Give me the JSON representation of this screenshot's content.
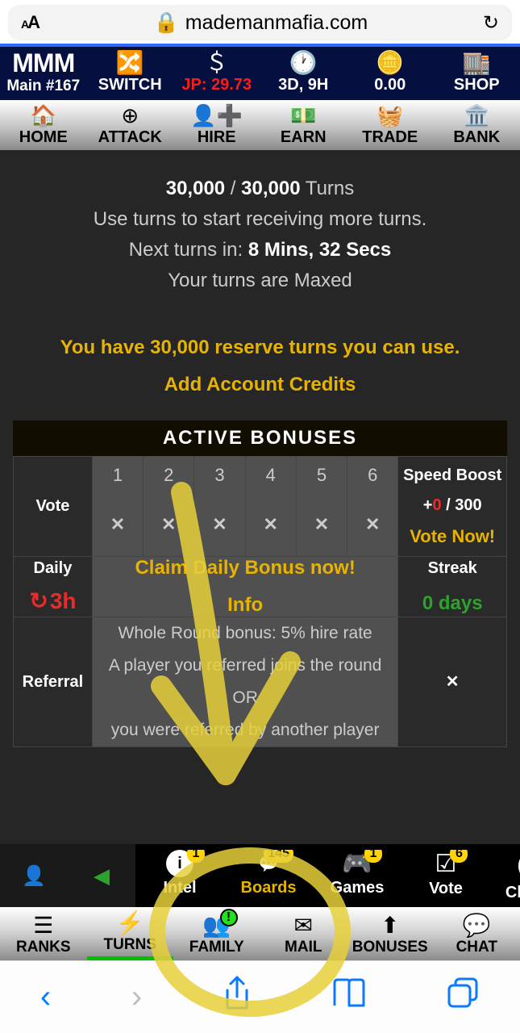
{
  "browser": {
    "url": "mademanmafia.com"
  },
  "nav1": {
    "mmm": "MMM",
    "main": "Main #167",
    "switch": "SWITCH",
    "jp_prefix": "JP: ",
    "jp_val": "29.73",
    "time": "3D, 9H",
    "coins": "0.00",
    "shop": "SHOP"
  },
  "nav2": {
    "home": "HOME",
    "attack": "ATTACK",
    "hire": "HIRE",
    "earn": "EARN",
    "trade": "TRADE",
    "bank": "BANK"
  },
  "turns": {
    "cur": "30,000",
    "max": "30,000",
    "suffix": " Turns",
    "hint": "Use turns to start receiving more turns.",
    "next_prefix": "Next turns in: ",
    "next_val": "8 Mins, 32 Secs",
    "maxed": "Your turns are Maxed"
  },
  "reserve": {
    "msg": "You have 30,000 reserve turns you can use.",
    "add": "Add Account Credits"
  },
  "bonuses": {
    "title": "ACTIVE BONUSES",
    "vote_label": "Vote",
    "cols": [
      "1",
      "2",
      "3",
      "4",
      "5",
      "6"
    ],
    "x": "✕",
    "speed_label": "Speed Boost",
    "speed_plus": "+",
    "speed_num": "0",
    "speed_sep": " / ",
    "speed_tot": "300",
    "vote_now": "Vote Now!",
    "daily_label": "Daily",
    "daily_timer": "3h",
    "claim": "Claim Daily Bonus now!",
    "info": "Info",
    "streak_label": "Streak",
    "streak_val": "0 days",
    "ref_label": "Referral",
    "ref_l1": "Whole Round bonus: 5% hire rate",
    "ref_l2": "A player you referred joins the round OR",
    "ref_l3": "you were referred by another player",
    "ref_x": "✕"
  },
  "gstrip": {
    "items": [
      {
        "label": "Intel",
        "badge": "1"
      },
      {
        "label": "Boards",
        "badge": "145",
        "active": true
      },
      {
        "label": "Games",
        "badge": "1"
      },
      {
        "label": "Vote",
        "badge": "6"
      },
      {
        "label": "Challen"
      }
    ]
  },
  "gstrip2": {
    "ranks": "RANKS",
    "turns": "TURNS",
    "family": "FAMILY",
    "fam_badge": "!",
    "mail": "MAIL",
    "bonuses": "BONUSES",
    "chat": "CHAT"
  }
}
